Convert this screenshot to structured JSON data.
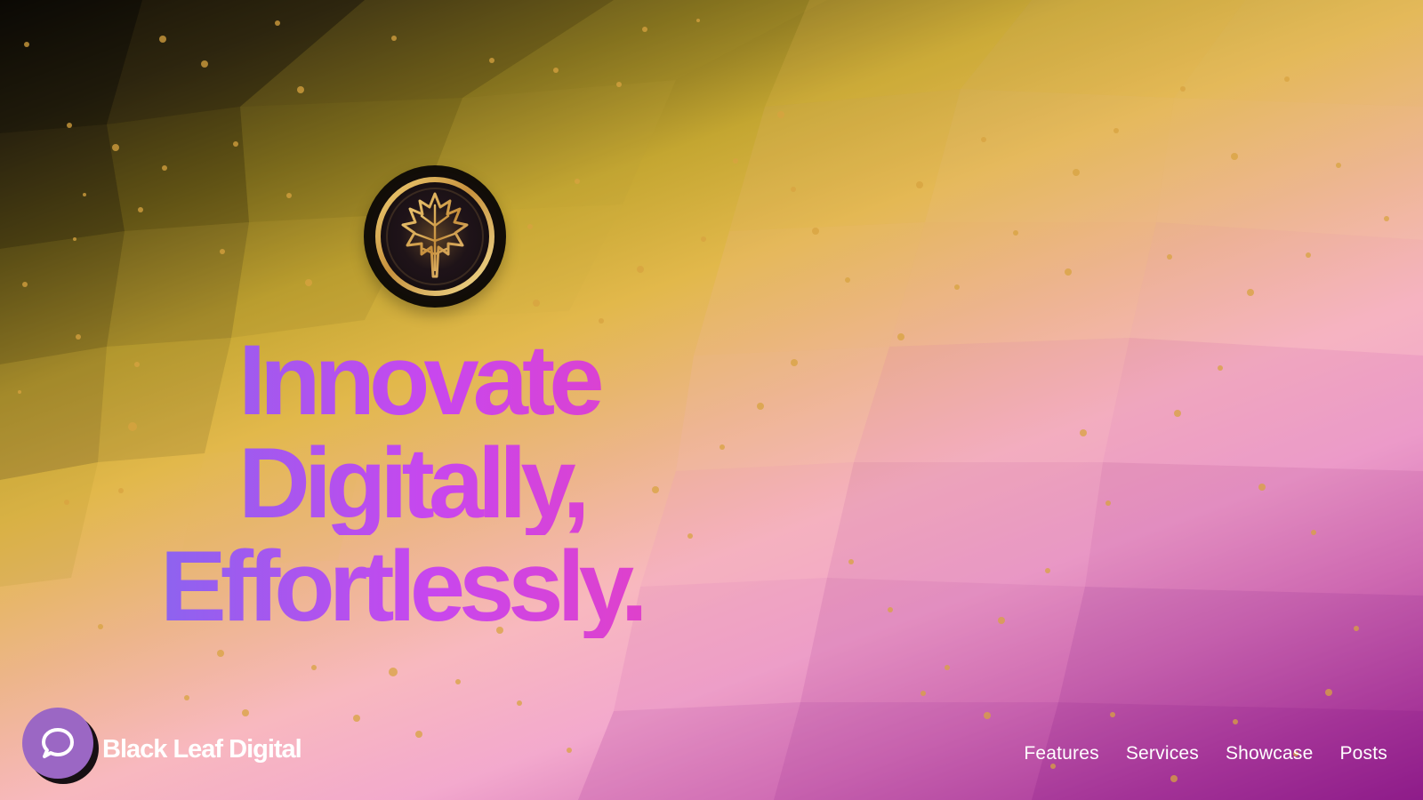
{
  "site": {
    "name": "Black Leaf Digital"
  },
  "hero": {
    "headline_lines": [
      "Innovate",
      "Digitally,",
      "Effortlessly."
    ],
    "logo_icon": "maple-leaf-icon"
  },
  "nav": {
    "items": [
      "Features",
      "Services",
      "Showcase",
      "Posts"
    ]
  },
  "chat": {
    "icon": "chat-bubble-icon"
  },
  "colors": {
    "headline_start": "#8d63ef",
    "headline_mid": "#c847ee",
    "headline_end": "#ec3db7",
    "chat_button": "#9b67c4",
    "logo_background": "#110d07",
    "logo_gold": "#d7ad54"
  }
}
